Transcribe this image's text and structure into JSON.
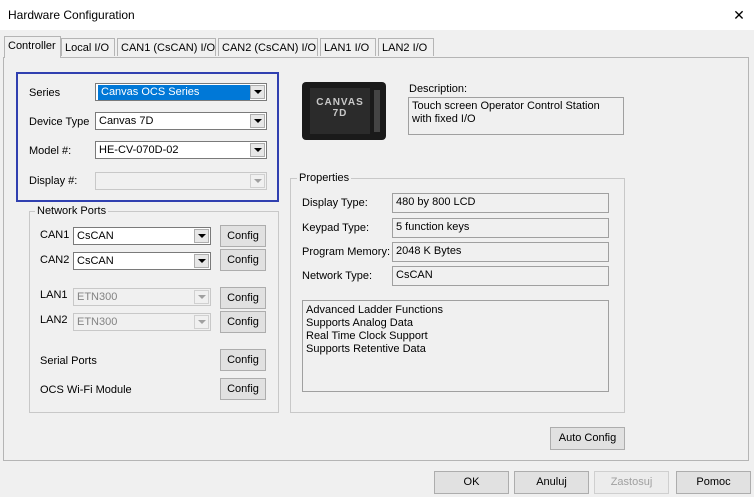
{
  "window": {
    "title": "Hardware Configuration",
    "close_glyph": "✕"
  },
  "tabs": [
    {
      "label": "Controller"
    },
    {
      "label": "Local I/O"
    },
    {
      "label": "CAN1 (CsCAN) I/O"
    },
    {
      "label": "CAN2 (CsCAN) I/O"
    },
    {
      "label": "LAN1 I/O"
    },
    {
      "label": "LAN2 I/O"
    }
  ],
  "controller": {
    "series": {
      "label": "Series",
      "value": "Canvas OCS Series"
    },
    "device_type": {
      "label": "Device Type",
      "value": "Canvas 7D"
    },
    "model": {
      "label": "Model #:",
      "value": "HE-CV-070D-02"
    },
    "display": {
      "label": "Display #:",
      "value": ""
    }
  },
  "device_image": {
    "line1": "CANVAS",
    "line2": "7D"
  },
  "description": {
    "label": "Description:",
    "text": "Touch screen Operator Control Station with fixed I/O"
  },
  "network_ports": {
    "title": "Network Ports",
    "can1": {
      "label": "CAN1",
      "value": "CsCAN",
      "config": "Config"
    },
    "can2": {
      "label": "CAN2",
      "value": "CsCAN",
      "config": "Config"
    },
    "lan1": {
      "label": "LAN1",
      "value": "ETN300",
      "config": "Config"
    },
    "lan2": {
      "label": "LAN2",
      "value": "ETN300",
      "config": "Config"
    },
    "serial": {
      "label": "Serial Ports",
      "config": "Config"
    },
    "wifi": {
      "label": "OCS Wi-Fi Module",
      "config": "Config"
    }
  },
  "properties": {
    "title": "Properties",
    "display_type": {
      "label": "Display Type:",
      "value": "480 by 800 LCD"
    },
    "keypad_type": {
      "label": "Keypad Type:",
      "value": "5 function keys"
    },
    "program_memory": {
      "label": "Program Memory:",
      "value": "2048 K Bytes"
    },
    "network_type": {
      "label": "Network Type:",
      "value": "CsCAN"
    },
    "features": [
      "Advanced Ladder Functions",
      "Supports Analog Data",
      "Real Time Clock Support",
      "Supports Retentive Data"
    ]
  },
  "auto_config": "Auto Config",
  "buttons": {
    "ok": "OK",
    "cancel": "Anuluj",
    "apply": "Zastosuj",
    "help": "Pomoc"
  },
  "colors": {
    "accent": "#0078d7",
    "highlight_border": "#3040b0"
  }
}
